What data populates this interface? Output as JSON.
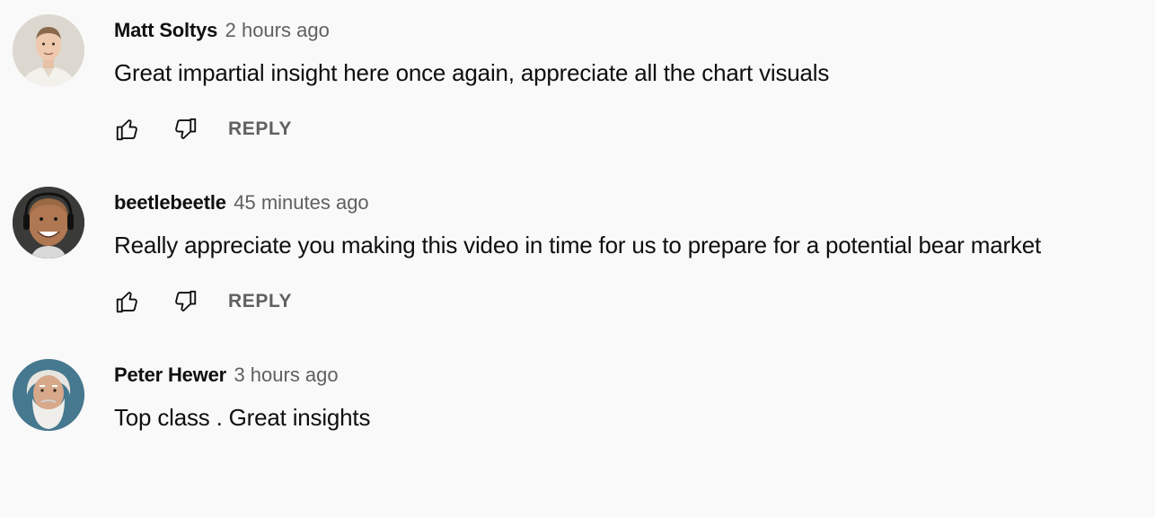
{
  "comments": [
    {
      "author": "Matt Soltys",
      "time": "2 hours ago",
      "text": "Great impartial insight here once again, appreciate all the chart visuals",
      "reply_label": "REPLY",
      "avatar_icon": "user-avatar-icon"
    },
    {
      "author": "beetlebeetle",
      "time": "45 minutes ago",
      "text": "Really appreciate you making this video in time for us to prepare for a potential bear market",
      "reply_label": "REPLY",
      "avatar_icon": "user-avatar-icon"
    },
    {
      "author": "Peter Hewer",
      "time": "3 hours ago",
      "text": "Top class . Great insights"
    }
  ],
  "icons": {
    "like": "thumbs-up-icon",
    "dislike": "thumbs-down-icon"
  },
  "colors": {
    "background": "#f9f9f9",
    "text": "#0f0f0f",
    "secondary": "#606060"
  }
}
